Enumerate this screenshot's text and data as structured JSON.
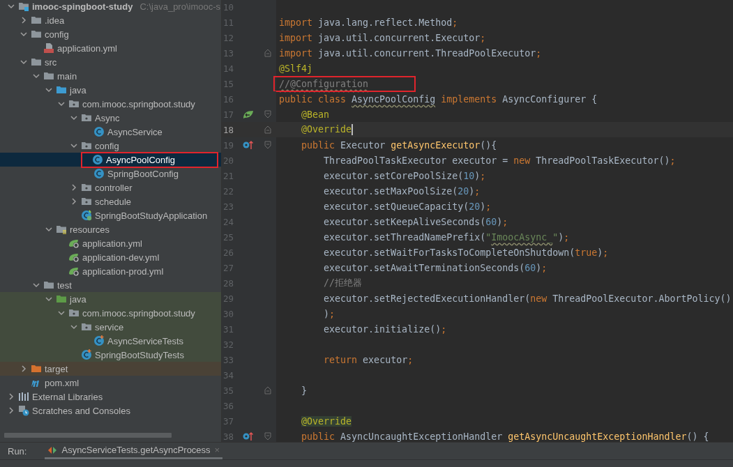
{
  "project_tree": {
    "items": [
      {
        "name": "imooc-spingboot-study",
        "path": "C:\\java_pro\\imooc-s",
        "kind": "module",
        "expanded": true,
        "selected": false,
        "children": [
          {
            "name": ".idea",
            "kind": "folder",
            "expanded": false,
            "selected": false
          },
          {
            "name": "config",
            "kind": "folder",
            "expanded": true,
            "selected": false,
            "children": [
              {
                "name": "application.yml",
                "kind": "yml",
                "selected": false
              }
            ]
          },
          {
            "name": "src",
            "kind": "folder",
            "expanded": true,
            "selected": false,
            "children": [
              {
                "name": "main",
                "kind": "folder",
                "expanded": true,
                "selected": false,
                "children": [
                  {
                    "name": "java",
                    "kind": "source",
                    "expanded": true,
                    "selected": false,
                    "children": [
                      {
                        "name": "com.imooc.springboot.study",
                        "kind": "package",
                        "expanded": true,
                        "selected": false,
                        "children": [
                          {
                            "name": "Async",
                            "kind": "package",
                            "expanded": true,
                            "selected": false,
                            "children": [
                              {
                                "name": "AsyncService",
                                "kind": "class",
                                "selected": false
                              }
                            ]
                          },
                          {
                            "name": "config",
                            "kind": "package",
                            "expanded": true,
                            "selected": false,
                            "children": [
                              {
                                "name": "AsyncPoolConfig",
                                "kind": "class",
                                "selected": true,
                                "boxed": true
                              },
                              {
                                "name": "SpringBootConfig",
                                "kind": "class",
                                "selected": false
                              }
                            ]
                          },
                          {
                            "name": "controller",
                            "kind": "package",
                            "expanded": false,
                            "selected": false
                          },
                          {
                            "name": "schedule",
                            "kind": "package",
                            "expanded": false,
                            "selected": false
                          },
                          {
                            "name": "SpringBootStudyApplication",
                            "kind": "spring-class",
                            "selected": false
                          }
                        ]
                      }
                    ]
                  },
                  {
                    "name": "resources",
                    "kind": "resources",
                    "expanded": true,
                    "selected": false,
                    "children": [
                      {
                        "name": "application.yml",
                        "kind": "spring-yml",
                        "selected": false
                      },
                      {
                        "name": "application-dev.yml",
                        "kind": "spring-yml",
                        "selected": false
                      },
                      {
                        "name": "application-prod.yml",
                        "kind": "spring-yml",
                        "selected": false
                      }
                    ]
                  }
                ]
              },
              {
                "name": "test",
                "kind": "folder",
                "expanded": true,
                "selected": false,
                "children": [
                  {
                    "name": "java",
                    "kind": "test-source",
                    "expanded": true,
                    "selected": false,
                    "children": [
                      {
                        "name": "com.imooc.springboot.study",
                        "kind": "package",
                        "expanded": true,
                        "selected": false,
                        "children": [
                          {
                            "name": "service",
                            "kind": "package",
                            "expanded": true,
                            "selected": false,
                            "children": [
                              {
                                "name": "AsyncServiceTests",
                                "kind": "test-class",
                                "selected": false
                              }
                            ]
                          },
                          {
                            "name": "SpringBootStudyTests",
                            "kind": "test-class",
                            "selected": false
                          }
                        ]
                      }
                    ]
                  }
                ]
              }
            ]
          },
          {
            "name": "target",
            "kind": "excluded",
            "expanded": false,
            "selected": false
          },
          {
            "name": "pom.xml",
            "kind": "maven",
            "selected": false
          }
        ]
      },
      {
        "name": "External Libraries",
        "kind": "libraries",
        "expanded": false,
        "selected": false
      },
      {
        "name": "Scratches and Consoles",
        "kind": "scratches",
        "expanded": false,
        "selected": false
      }
    ]
  },
  "editor": {
    "lines": [
      {
        "number": "10",
        "current": false
      },
      {
        "number": "11",
        "current": false,
        "tokens": [
          {
            "text": "import",
            "kind": "kw"
          },
          {
            "text": " java.lang.reflect.Method",
            "kind": "plain"
          },
          {
            "text": ";",
            "kind": "kw"
          }
        ]
      },
      {
        "number": "12",
        "current": false,
        "tokens": [
          {
            "text": "import",
            "kind": "kw"
          },
          {
            "text": " java.util.concurrent.Executor",
            "kind": "plain"
          },
          {
            "text": ";",
            "kind": "kw"
          }
        ]
      },
      {
        "number": "13",
        "current": false,
        "fold": {
          "kind": "end"
        },
        "tokens": [
          {
            "text": "import",
            "kind": "kw"
          },
          {
            "text": " java.util.concurrent.ThreadPoolExecutor",
            "kind": "plain"
          },
          {
            "text": ";",
            "kind": "kw"
          }
        ]
      },
      {
        "number": "14",
        "current": false,
        "tokens": [
          {
            "text": "@Slf4j",
            "kind": "ann"
          }
        ]
      },
      {
        "number": "15",
        "current": false,
        "boxed": true,
        "tokens": [
          {
            "text": "//@Configuration",
            "kind": "comment",
            "wavy": true
          }
        ]
      },
      {
        "number": "16",
        "current": false,
        "tokens": [
          {
            "text": "public class ",
            "kind": "kw"
          },
          {
            "text": "AsyncPoolConfig",
            "kind": "plain",
            "wavy": true
          },
          {
            "text": " implements",
            "kind": "kw"
          },
          {
            "text": " AsyncConfigurer {",
            "kind": "plain"
          }
        ]
      },
      {
        "number": "17",
        "current": false,
        "gutter": {
          "kind": "bean"
        },
        "fold": {
          "kind": "start"
        },
        "tokens": [
          {
            "text": "    @Bean",
            "kind": "ann"
          }
        ]
      },
      {
        "number": "18",
        "current": true,
        "fold": {
          "kind": "end"
        },
        "tokens": [
          {
            "text": "    @Override",
            "kind": "ann"
          }
        ]
      },
      {
        "number": "19",
        "current": false,
        "gutter": {
          "kind": "override"
        },
        "fold": {
          "kind": "start"
        },
        "tokens": [
          {
            "text": "    public",
            "kind": "kw"
          },
          {
            "text": " Executor ",
            "kind": "plain"
          },
          {
            "text": "getAsyncExecutor",
            "kind": "method"
          },
          {
            "text": "(){",
            "kind": "plain"
          }
        ]
      },
      {
        "number": "20",
        "current": false,
        "tokens": [
          {
            "text": "        ThreadPoolTaskExecutor executor = ",
            "kind": "plain"
          },
          {
            "text": "new",
            "kind": "kw"
          },
          {
            "text": " ThreadPoolTaskExecutor()",
            "kind": "plain"
          },
          {
            "text": ";",
            "kind": "kw"
          }
        ]
      },
      {
        "number": "21",
        "current": false,
        "tokens": [
          {
            "text": "        executor.setCorePoolSize(",
            "kind": "plain"
          },
          {
            "text": "10",
            "kind": "num"
          },
          {
            "text": ")",
            "kind": "plain"
          },
          {
            "text": ";",
            "kind": "kw"
          }
        ]
      },
      {
        "number": "22",
        "current": false,
        "tokens": [
          {
            "text": "        executor.setMaxPoolSize(",
            "kind": "plain"
          },
          {
            "text": "20",
            "kind": "num"
          },
          {
            "text": ")",
            "kind": "plain"
          },
          {
            "text": ";",
            "kind": "kw"
          }
        ]
      },
      {
        "number": "23",
        "current": false,
        "tokens": [
          {
            "text": "        executor.setQueueCapacity(",
            "kind": "plain"
          },
          {
            "text": "20",
            "kind": "num"
          },
          {
            "text": ")",
            "kind": "plain"
          },
          {
            "text": ";",
            "kind": "kw"
          }
        ]
      },
      {
        "number": "24",
        "current": false,
        "tokens": [
          {
            "text": "        executor.setKeepAliveSeconds(",
            "kind": "plain"
          },
          {
            "text": "60",
            "kind": "num"
          },
          {
            "text": ")",
            "kind": "plain"
          },
          {
            "text": ";",
            "kind": "kw"
          }
        ]
      },
      {
        "number": "25",
        "current": false,
        "tokens": [
          {
            "text": "        executor.setThreadNamePrefix(",
            "kind": "plain"
          },
          {
            "text": "\"",
            "kind": "str"
          },
          {
            "text": "ImoocAsync_",
            "kind": "str",
            "wavy": true
          },
          {
            "text": "\"",
            "kind": "str"
          },
          {
            "text": ")",
            "kind": "plain"
          },
          {
            "text": ";",
            "kind": "kw"
          }
        ]
      },
      {
        "number": "26",
        "current": false,
        "tokens": [
          {
            "text": "        executor.setWaitForTasksToCompleteOnShutdown(",
            "kind": "plain"
          },
          {
            "text": "true",
            "kind": "kw"
          },
          {
            "text": ")",
            "kind": "plain"
          },
          {
            "text": ";",
            "kind": "kw"
          }
        ]
      },
      {
        "number": "27",
        "current": false,
        "tokens": [
          {
            "text": "        executor.setAwaitTerminationSeconds(",
            "kind": "plain"
          },
          {
            "text": "60",
            "kind": "num"
          },
          {
            "text": ")",
            "kind": "plain"
          },
          {
            "text": ";",
            "kind": "kw"
          }
        ]
      },
      {
        "number": "28",
        "current": false,
        "tokens": [
          {
            "text": "        //拒绝器",
            "kind": "comment"
          }
        ]
      },
      {
        "number": "29",
        "current": false,
        "tokens": [
          {
            "text": "        executor.setRejectedExecutionHandler(",
            "kind": "plain"
          },
          {
            "text": "new",
            "kind": "kw"
          },
          {
            "text": " ThreadPoolExecutor.AbortPolicy()",
            "kind": "plain"
          }
        ]
      },
      {
        "number": "30",
        "current": false,
        "tokens": [
          {
            "text": "        )",
            "kind": "plain"
          },
          {
            "text": ";",
            "kind": "kw"
          }
        ]
      },
      {
        "number": "31",
        "current": false,
        "tokens": [
          {
            "text": "        executor.initialize()",
            "kind": "plain"
          },
          {
            "text": ";",
            "kind": "kw"
          }
        ]
      },
      {
        "number": "32",
        "current": false
      },
      {
        "number": "33",
        "current": false,
        "tokens": [
          {
            "text": "        return",
            "kind": "kw"
          },
          {
            "text": " executor",
            "kind": "plain"
          },
          {
            "text": ";",
            "kind": "kw"
          }
        ]
      },
      {
        "number": "34",
        "current": false
      },
      {
        "number": "35",
        "current": false,
        "fold": {
          "kind": "end"
        },
        "tokens": [
          {
            "text": "    }",
            "kind": "plain"
          }
        ]
      },
      {
        "number": "36",
        "current": false
      },
      {
        "number": "37",
        "current": false,
        "tokens": [
          {
            "text": "    @Override",
            "kind": "ann",
            "highlight": true
          }
        ]
      },
      {
        "number": "38",
        "current": false,
        "gutter": {
          "kind": "override"
        },
        "fold": {
          "kind": "start"
        },
        "tokens": [
          {
            "text": "    public",
            "kind": "kw"
          },
          {
            "text": " AsyncUncaughtExceptionHandler ",
            "kind": "plain"
          },
          {
            "text": "getAsyncUncaughtExceptionHandler",
            "kind": "method"
          },
          {
            "text": "() {",
            "kind": "plain"
          }
        ]
      }
    ]
  },
  "run_bar": {
    "label": "Run:",
    "tabs": [
      {
        "title": "AsyncServiceTests.getAsyncProcess",
        "close": "×",
        "selected": true
      }
    ]
  }
}
